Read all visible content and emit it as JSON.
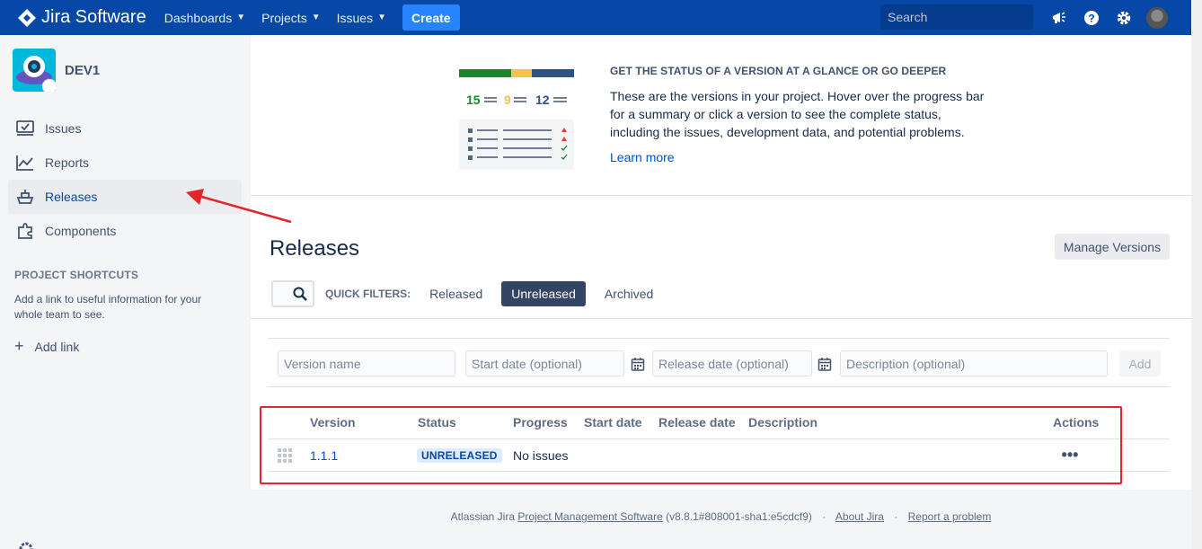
{
  "topnav": {
    "logo_text": "Jira Software",
    "menus": [
      {
        "label": "Dashboards"
      },
      {
        "label": "Projects"
      },
      {
        "label": "Issues"
      }
    ],
    "create_label": "Create",
    "search_placeholder": "Search",
    "icons": [
      "megaphone-icon",
      "help-icon",
      "settings-icon",
      "user-avatar"
    ]
  },
  "sidebar": {
    "project_name": "DEV1",
    "items": [
      {
        "label": "Issues",
        "icon": "issues-icon"
      },
      {
        "label": "Reports",
        "icon": "reports-icon"
      },
      {
        "label": "Releases",
        "icon": "releases-icon",
        "active": true
      },
      {
        "label": "Components",
        "icon": "components-icon"
      }
    ],
    "shortcuts_title": "PROJECT SHORTCUTS",
    "shortcuts_desc": "Add a link to useful information for your whole team to see.",
    "add_link_label": "Add link"
  },
  "intro": {
    "stats": [
      "15",
      "9",
      "12"
    ],
    "title": "GET THE STATUS OF A VERSION AT A GLANCE OR GO DEEPER",
    "body": "These are the versions in your project. Hover over the progress bar for a summary or click a version to see the complete status, including the issues, development data, and potential problems.",
    "learn_more": "Learn more"
  },
  "releases": {
    "title": "Releases",
    "manage_label": "Manage Versions",
    "quick_filters_label": "QUICK FILTERS:",
    "filters": [
      "Released",
      "Unreleased",
      "Archived"
    ],
    "active_filter": "Unreleased"
  },
  "add_version": {
    "name_placeholder": "Version name",
    "start_placeholder": "Start date (optional)",
    "release_placeholder": "Release date (optional)",
    "desc_placeholder": "Description (optional)",
    "add_label": "Add"
  },
  "table": {
    "headers": {
      "version": "Version",
      "status": "Status",
      "progress": "Progress",
      "start": "Start date",
      "release": "Release date",
      "description": "Description",
      "actions": "Actions"
    },
    "rows": [
      {
        "version": "1.1.1",
        "status": "UNRELEASED",
        "progress": "No issues",
        "actions": "•••"
      }
    ]
  },
  "footer": {
    "prefix": "Atlassian Jira",
    "product_link": "Project Management Software",
    "version": "(v8.8.1#808001-sha1:e5cdcf9)",
    "about": "About Jira",
    "report": "Report a problem"
  },
  "colors": {
    "nav_bg": "#0747a6",
    "create_bg": "#2684ff",
    "active_filter_bg": "#344563",
    "annotation_red": "#e5252a",
    "stat_green": "#14892c",
    "stat_yellow": "#f6c342",
    "stat_blue": "#2c5282"
  }
}
